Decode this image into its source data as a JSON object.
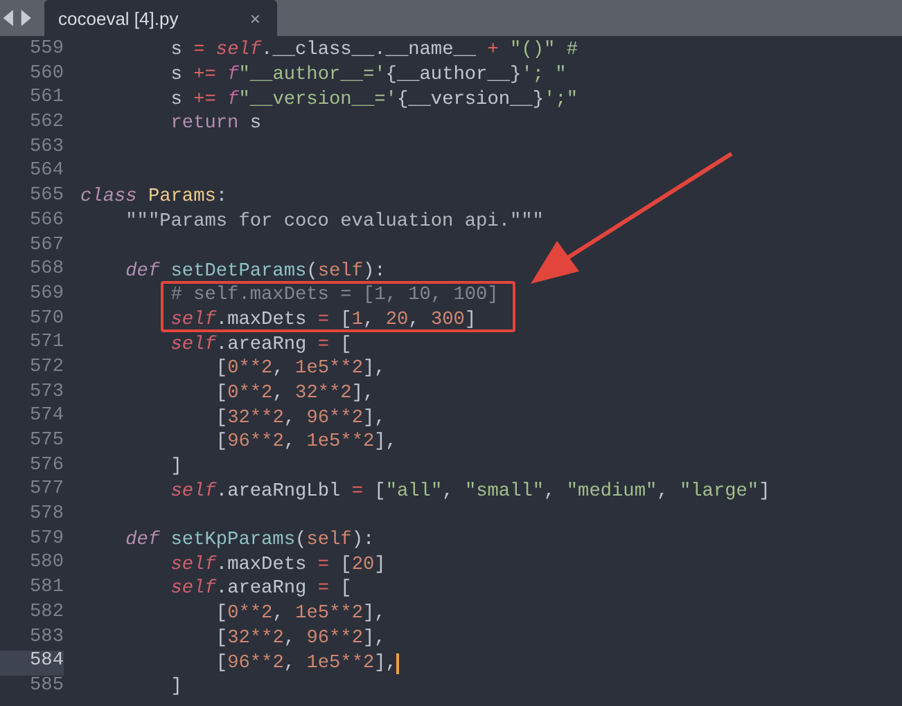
{
  "tab": {
    "title": "cocoeval [4].py",
    "close": "×",
    "selected": true
  },
  "lines": [
    {
      "number": "559",
      "current": false,
      "tokens": [
        {
          "kind": "plain",
          "text": "        s "
        },
        {
          "kind": "op",
          "text": "="
        },
        {
          "kind": "self",
          "text": " self"
        },
        {
          "kind": "plain",
          "text": ".__class__.__name__ "
        },
        {
          "kind": "op",
          "text": "+"
        },
        {
          "kind": "str",
          "text": " \"()\" #"
        }
      ]
    },
    {
      "number": "560",
      "current": false,
      "tokens": [
        {
          "kind": "plain",
          "text": "        s "
        },
        {
          "kind": "op",
          "text": "+="
        },
        {
          "kind": "fprefix",
          "text": " f"
        },
        {
          "kind": "str",
          "text": "\"__author__='"
        },
        {
          "kind": "plain",
          "text": "{__author__}"
        },
        {
          "kind": "str",
          "text": "'; \""
        }
      ]
    },
    {
      "number": "561",
      "current": false,
      "tokens": [
        {
          "kind": "plain",
          "text": "        s "
        },
        {
          "kind": "op",
          "text": "+="
        },
        {
          "kind": "fprefix",
          "text": " f"
        },
        {
          "kind": "str",
          "text": "\"__version__='"
        },
        {
          "kind": "plain",
          "text": "{__version__}"
        },
        {
          "kind": "str",
          "text": "';\""
        }
      ]
    },
    {
      "number": "562",
      "current": false,
      "tokens": [
        {
          "kind": "ret",
          "text": "        return"
        },
        {
          "kind": "plain",
          "text": " s"
        }
      ]
    },
    {
      "number": "563",
      "current": false
    },
    {
      "number": "564",
      "current": false
    },
    {
      "number": "565",
      "current": false,
      "tokens": [
        {
          "kind": "kw",
          "text": "class"
        },
        {
          "kind": "cls",
          "text": " Params"
        },
        {
          "kind": "plain",
          "text": ":"
        }
      ]
    },
    {
      "number": "566",
      "current": false,
      "tokens": [
        {
          "kind": "doc",
          "text": "    \"\"\"Params for coco evaluation api.\"\"\""
        }
      ]
    },
    {
      "number": "567",
      "current": false
    },
    {
      "number": "568",
      "current": false,
      "tokens": [
        {
          "kind": "kw",
          "text": "    def"
        },
        {
          "kind": "fn",
          "text": " setDetParams"
        },
        {
          "kind": "plain",
          "text": "("
        },
        {
          "kind": "arg",
          "text": "self"
        },
        {
          "kind": "plain",
          "text": "):"
        }
      ]
    },
    {
      "number": "569",
      "current": false,
      "tokens": [
        {
          "kind": "comment",
          "text": "        # self.maxDets = [1, 10, 100]"
        }
      ]
    },
    {
      "number": "570",
      "current": false,
      "tokens": [
        {
          "kind": "self",
          "text": "        self"
        },
        {
          "kind": "plain",
          "text": ".maxDets "
        },
        {
          "kind": "op",
          "text": "="
        },
        {
          "kind": "plain",
          "text": " ["
        },
        {
          "kind": "num",
          "text": "1"
        },
        {
          "kind": "plain",
          "text": ", "
        },
        {
          "kind": "num",
          "text": "20"
        },
        {
          "kind": "plain",
          "text": ", "
        },
        {
          "kind": "num",
          "text": "300"
        },
        {
          "kind": "plain",
          "text": "]"
        }
      ]
    },
    {
      "number": "571",
      "current": false,
      "tokens": [
        {
          "kind": "self",
          "text": "        self"
        },
        {
          "kind": "plain",
          "text": ".areaRng "
        },
        {
          "kind": "op",
          "text": "="
        },
        {
          "kind": "plain",
          "text": " ["
        }
      ]
    },
    {
      "number": "572",
      "current": false,
      "tokens": [
        {
          "kind": "plain",
          "text": "            ["
        },
        {
          "kind": "num",
          "text": "0**2"
        },
        {
          "kind": "plain",
          "text": ", "
        },
        {
          "kind": "num",
          "text": "1e5**2"
        },
        {
          "kind": "plain",
          "text": "],"
        }
      ]
    },
    {
      "number": "573",
      "current": false,
      "tokens": [
        {
          "kind": "plain",
          "text": "            ["
        },
        {
          "kind": "num",
          "text": "0**2"
        },
        {
          "kind": "plain",
          "text": ", "
        },
        {
          "kind": "num",
          "text": "32**2"
        },
        {
          "kind": "plain",
          "text": "],"
        }
      ]
    },
    {
      "number": "574",
      "current": false,
      "tokens": [
        {
          "kind": "plain",
          "text": "            ["
        },
        {
          "kind": "num",
          "text": "32**2"
        },
        {
          "kind": "plain",
          "text": ", "
        },
        {
          "kind": "num",
          "text": "96**2"
        },
        {
          "kind": "plain",
          "text": "],"
        }
      ]
    },
    {
      "number": "575",
      "current": false,
      "tokens": [
        {
          "kind": "plain",
          "text": "            ["
        },
        {
          "kind": "num",
          "text": "96**2"
        },
        {
          "kind": "plain",
          "text": ", "
        },
        {
          "kind": "num",
          "text": "1e5**2"
        },
        {
          "kind": "plain",
          "text": "],"
        }
      ]
    },
    {
      "number": "576",
      "current": false,
      "tokens": [
        {
          "kind": "plain",
          "text": "        ]"
        }
      ]
    },
    {
      "number": "577",
      "current": false,
      "tokens": [
        {
          "kind": "self",
          "text": "        self"
        },
        {
          "kind": "plain",
          "text": ".areaRngLbl "
        },
        {
          "kind": "op",
          "text": "="
        },
        {
          "kind": "plain",
          "text": " ["
        },
        {
          "kind": "str",
          "text": "\"all\""
        },
        {
          "kind": "plain",
          "text": ", "
        },
        {
          "kind": "str",
          "text": "\"small\""
        },
        {
          "kind": "plain",
          "text": ", "
        },
        {
          "kind": "str",
          "text": "\"medium\""
        },
        {
          "kind": "plain",
          "text": ", "
        },
        {
          "kind": "str",
          "text": "\"large\""
        },
        {
          "kind": "plain",
          "text": "]"
        }
      ]
    },
    {
      "number": "578",
      "current": false
    },
    {
      "number": "579",
      "current": false,
      "tokens": [
        {
          "kind": "kw",
          "text": "    def"
        },
        {
          "kind": "fn",
          "text": " setKpParams"
        },
        {
          "kind": "plain",
          "text": "("
        },
        {
          "kind": "arg",
          "text": "self"
        },
        {
          "kind": "plain",
          "text": "):"
        }
      ]
    },
    {
      "number": "580",
      "current": false,
      "tokens": [
        {
          "kind": "self",
          "text": "        self"
        },
        {
          "kind": "plain",
          "text": ".maxDets "
        },
        {
          "kind": "op",
          "text": "="
        },
        {
          "kind": "plain",
          "text": " ["
        },
        {
          "kind": "num",
          "text": "20"
        },
        {
          "kind": "plain",
          "text": "]"
        }
      ]
    },
    {
      "number": "581",
      "current": false,
      "tokens": [
        {
          "kind": "self",
          "text": "        self"
        },
        {
          "kind": "plain",
          "text": ".areaRng "
        },
        {
          "kind": "op",
          "text": "="
        },
        {
          "kind": "plain",
          "text": " ["
        }
      ]
    },
    {
      "number": "582",
      "current": false,
      "tokens": [
        {
          "kind": "plain",
          "text": "            ["
        },
        {
          "kind": "num",
          "text": "0**2"
        },
        {
          "kind": "plain",
          "text": ", "
        },
        {
          "kind": "num",
          "text": "1e5**2"
        },
        {
          "kind": "plain",
          "text": "],"
        }
      ]
    },
    {
      "number": "583",
      "current": false,
      "tokens": [
        {
          "kind": "plain",
          "text": "            ["
        },
        {
          "kind": "num",
          "text": "32**2"
        },
        {
          "kind": "plain",
          "text": ", "
        },
        {
          "kind": "num",
          "text": "96**2"
        },
        {
          "kind": "plain",
          "text": "],"
        }
      ]
    },
    {
      "number": "584",
      "current": true,
      "tokens": [
        {
          "kind": "plain",
          "text": "            ["
        },
        {
          "kind": "num",
          "text": "96**2"
        },
        {
          "kind": "plain",
          "text": ", "
        },
        {
          "kind": "num",
          "text": "1e5**2"
        },
        {
          "kind": "plain",
          "text": "],"
        }
      ]
    },
    {
      "number": "585",
      "current": false,
      "tokens": [
        {
          "kind": "plain",
          "text": "        ]"
        }
      ]
    }
  ]
}
